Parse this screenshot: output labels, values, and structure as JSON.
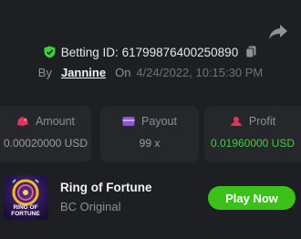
{
  "bet": {
    "id_label": "Betting ID: 61799876400250890",
    "by_label": "By",
    "user": "Jannine",
    "on_label": "On",
    "timestamp": "4/24/2022, 10:15:30 PM"
  },
  "stats": [
    {
      "label": "Amount",
      "value": "0.00020000 USD",
      "icon": "money-bag-icon",
      "icon_color": "#e0355c"
    },
    {
      "label": "Payout",
      "value": "99 x",
      "icon": "payout-card-icon",
      "icon_color": "#8a55e0"
    },
    {
      "label": "Profit",
      "value": "0.01960000 USD",
      "icon": "profit-icon",
      "icon_color": "#e0355c",
      "value_color": "#3fcf3a"
    }
  ],
  "game": {
    "title": "Ring of Fortune",
    "provider": "BC Original",
    "thumb_text_line1": "RING OF",
    "thumb_text_line2": "FORTUNE",
    "play_label": "Play Now"
  },
  "colors": {
    "background": "#1e1f22",
    "card": "#25272b",
    "accent_green": "#3bc117",
    "shield_green": "#3fcf3a"
  }
}
